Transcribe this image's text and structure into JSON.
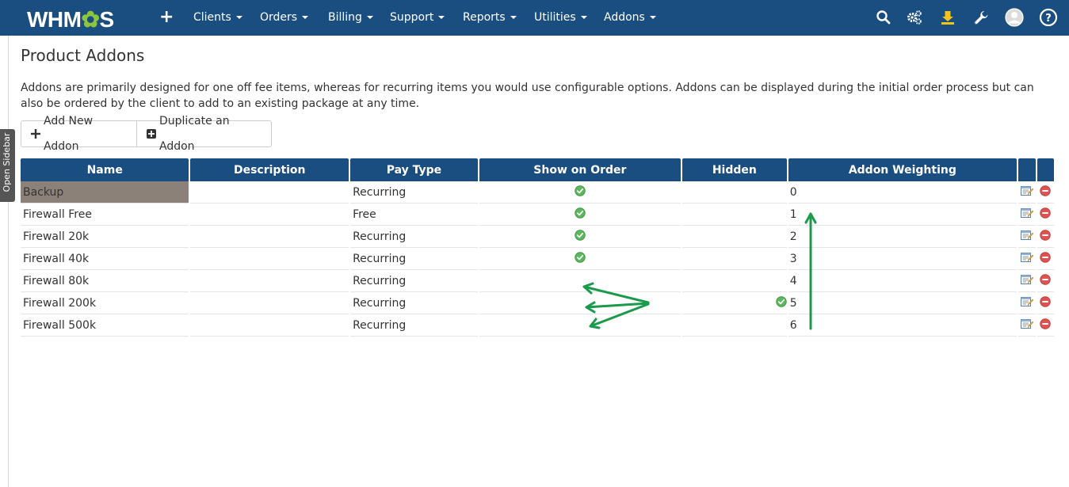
{
  "nav": {
    "logo_prefix": "WHM",
    "logo_suffix": "S",
    "items": [
      {
        "label": "Clients"
      },
      {
        "label": "Orders"
      },
      {
        "label": "Billing"
      },
      {
        "label": "Support"
      },
      {
        "label": "Reports"
      },
      {
        "label": "Utilities"
      },
      {
        "label": "Addons"
      }
    ],
    "icons": [
      "search-icon",
      "gears-icon",
      "download-icon",
      "wrench-icon",
      "user-avatar-icon",
      "help-icon"
    ]
  },
  "sidebar": {
    "open_label": "Open Sidebar"
  },
  "page": {
    "title": "Product Addons",
    "description": "Addons are primarily designed for one off fee items, whereas for recurring items you would use configurable options. Addons can be displayed during the initial order process but can also be ordered by the client to add to an existing package at any time."
  },
  "buttons": {
    "add_new": "Add New Addon",
    "duplicate": "Duplicate an Addon"
  },
  "table": {
    "headers": [
      "Name",
      "Description",
      "Pay Type",
      "Show on Order",
      "Hidden",
      "Addon Weighting"
    ],
    "rows": [
      {
        "name": "Backup",
        "description": "",
        "pay_type": "Recurring",
        "show_on_order": true,
        "hidden": false,
        "weighting": "0"
      },
      {
        "name": "Firewall Free",
        "description": "",
        "pay_type": "Free",
        "show_on_order": true,
        "hidden": false,
        "weighting": "1"
      },
      {
        "name": "Firewall 20k",
        "description": "",
        "pay_type": "Recurring",
        "show_on_order": true,
        "hidden": false,
        "weighting": "2"
      },
      {
        "name": "Firewall 40k",
        "description": "",
        "pay_type": "Recurring",
        "show_on_order": true,
        "hidden": false,
        "weighting": "3"
      },
      {
        "name": "Firewall 80k",
        "description": "",
        "pay_type": "Recurring",
        "show_on_order": false,
        "hidden": false,
        "weighting": "4"
      },
      {
        "name": "Firewall 200k",
        "description": "",
        "pay_type": "Recurring",
        "show_on_order": false,
        "hidden": true,
        "weighting": "5"
      },
      {
        "name": "Firewall 500k",
        "description": "",
        "pay_type": "Recurring",
        "show_on_order": false,
        "hidden": false,
        "weighting": "6"
      }
    ]
  },
  "colors": {
    "navbar": "#1a4d80",
    "accent_green": "#8cc63f",
    "annotation_arrow": "#1a9a4a",
    "highlight_row": "#8c8179"
  }
}
